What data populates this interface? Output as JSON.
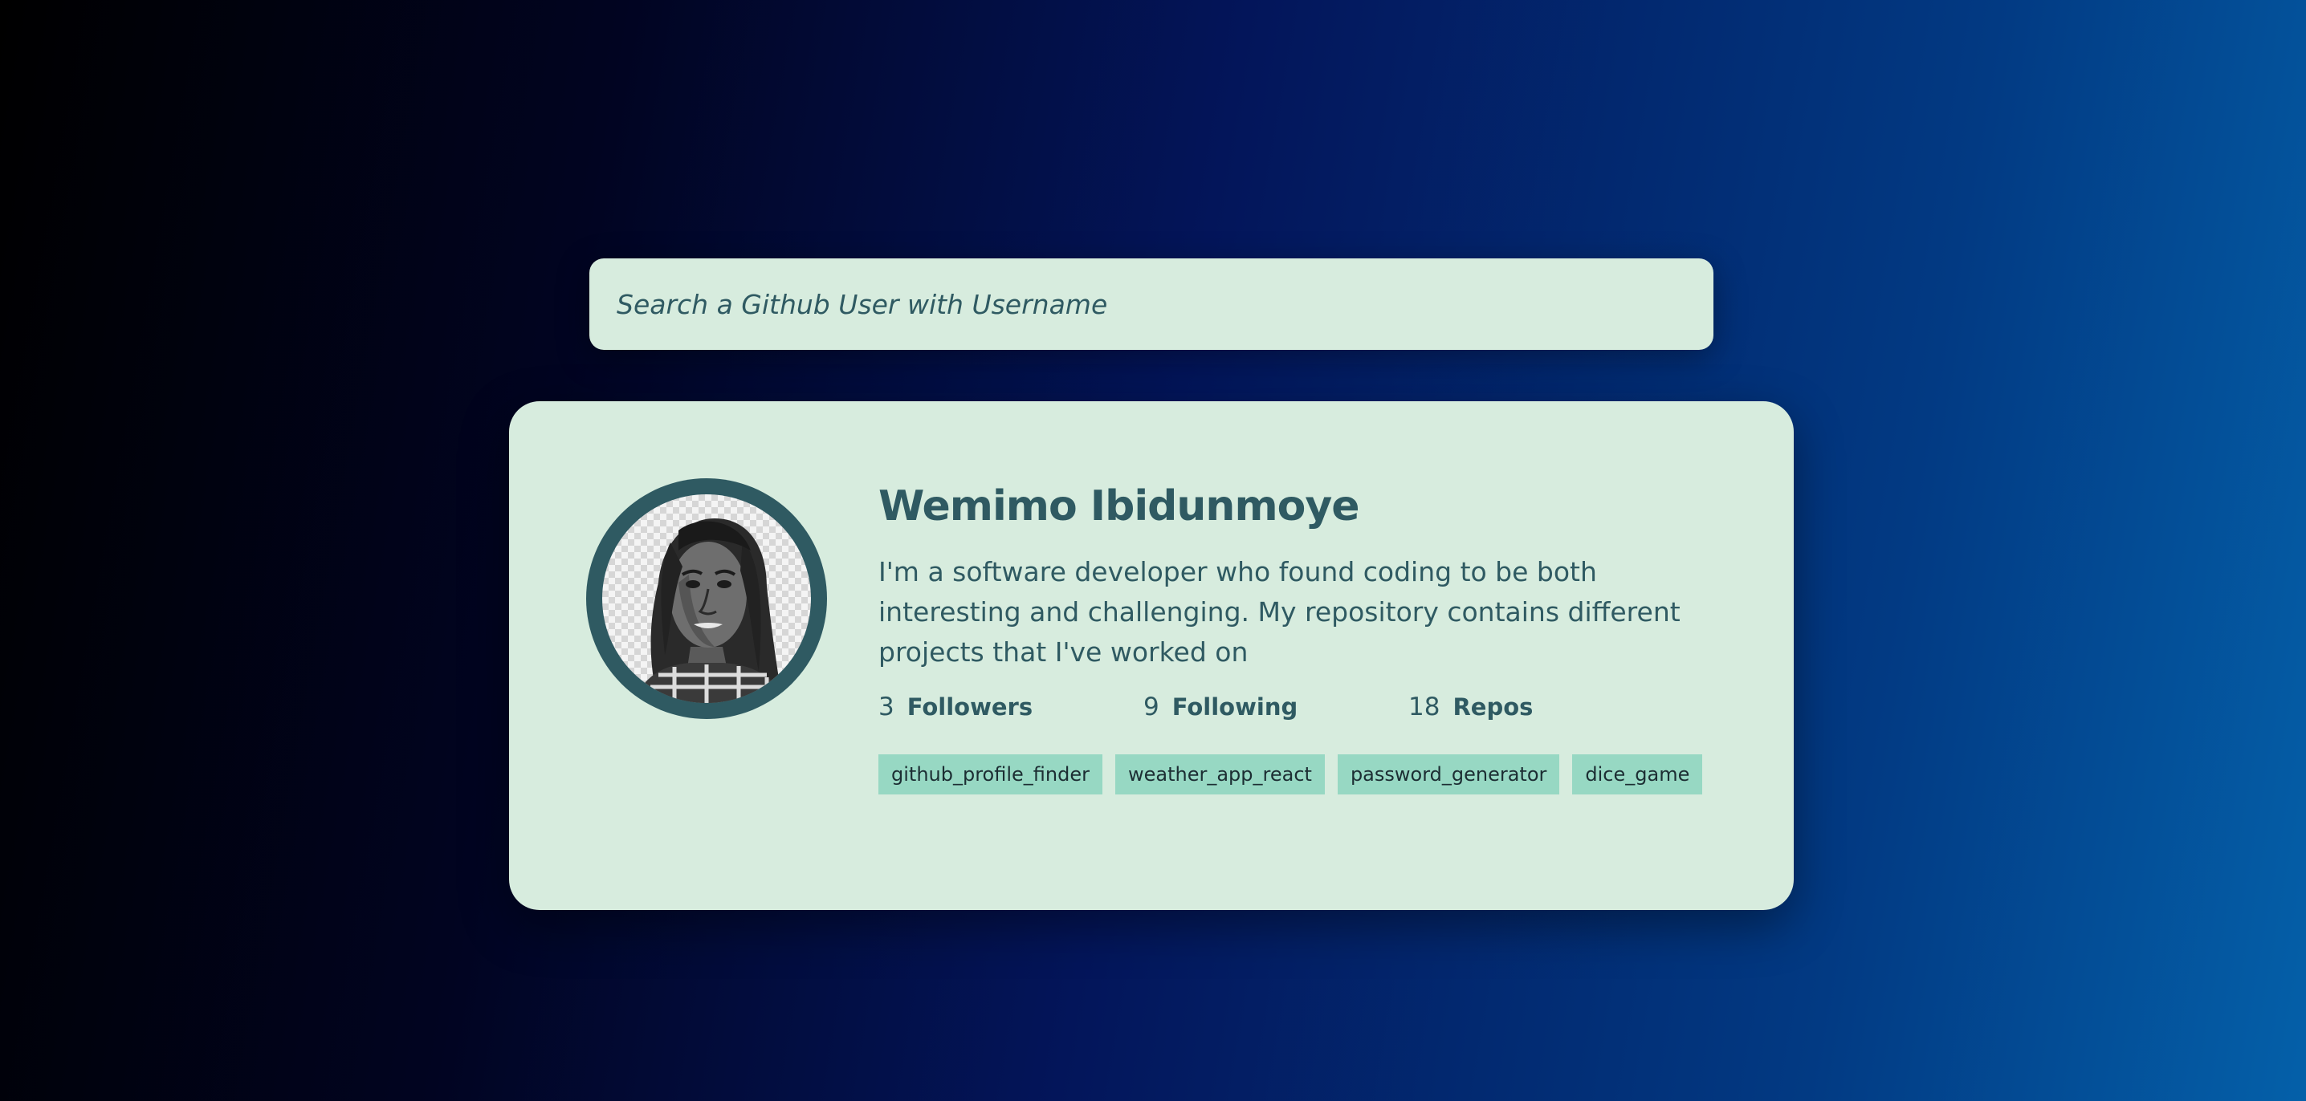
{
  "search": {
    "placeholder": "Search a Github User with Username",
    "value": ""
  },
  "profile": {
    "name": "Wemimo Ibidunmoye",
    "bio": "I'm a software developer who found coding to be both interesting and challenging. My repository contains different projects that I've worked on",
    "stats": [
      {
        "count": "3",
        "label": "Followers"
      },
      {
        "count": "9",
        "label": "Following"
      },
      {
        "count": "18",
        "label": "Repos"
      }
    ],
    "repos": [
      "github_profile_finder",
      "weather_app_react",
      "password_generator",
      "dice_game"
    ]
  },
  "colors": {
    "card_background": "#d7ecde",
    "primary_text": "#2f5a62",
    "repo_tag": "#97d8c3"
  },
  "icons": {
    "avatar": "user-avatar-photo"
  }
}
